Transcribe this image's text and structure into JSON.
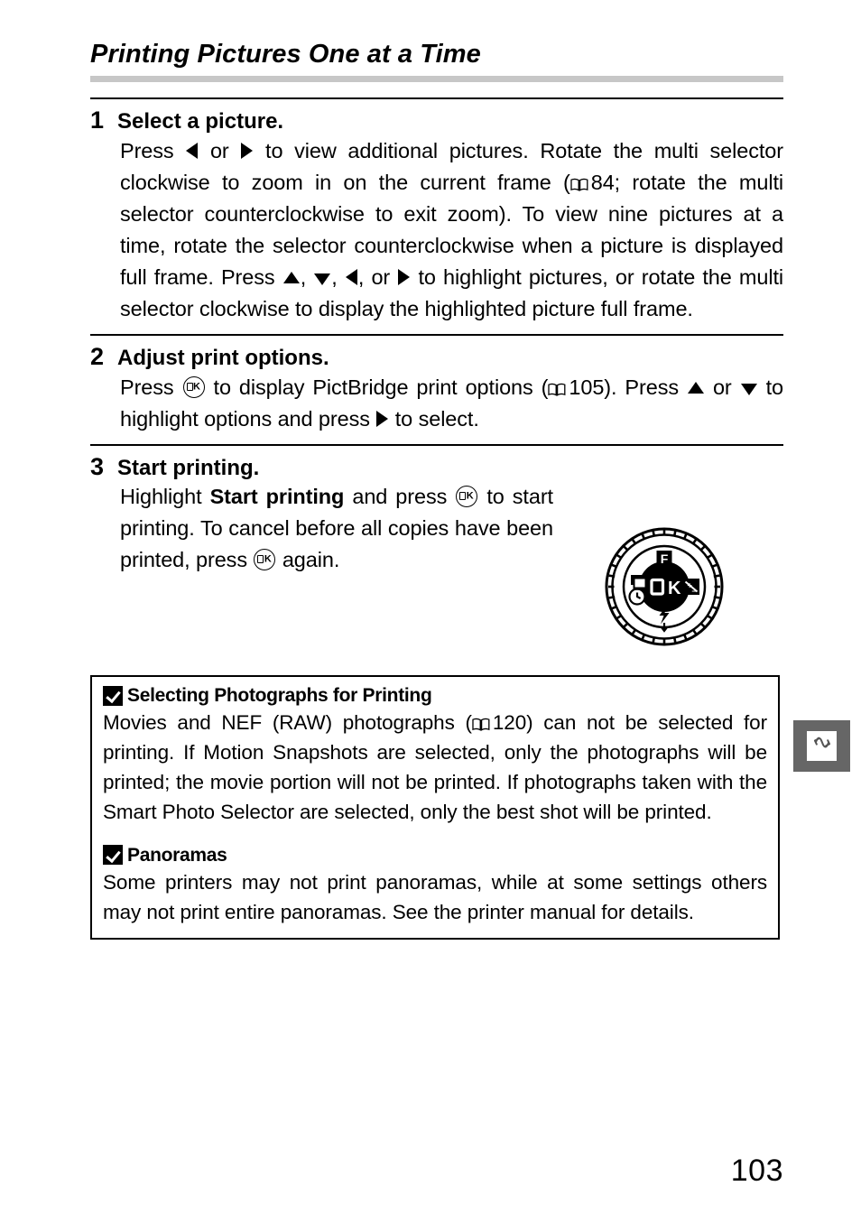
{
  "page": {
    "title": "Printing Pictures One at a Time",
    "number": "103"
  },
  "steps": [
    {
      "num": "1",
      "title": "Select a picture.",
      "body_parts": {
        "p1": "Press ",
        "p2": " or ",
        "p3": " to view additional pictures. Rotate the multi selector clockwise to zoom in on the current frame (",
        "ref1": "84",
        "p4": "; rotate the multi selector counterclockwise to exit zoom).  To view nine pictures at a time, rotate the selector counterclockwise when a picture is displayed full frame.  Press ",
        "p5": ", ",
        "p6": ", ",
        "p7": ", or ",
        "p8": " to highlight pictures, or rotate the multi selector clockwise to display the highlighted picture full frame."
      }
    },
    {
      "num": "2",
      "title": "Adjust print options.",
      "body_parts": {
        "p1": "Press ",
        "p2": " to display PictBridge print options (",
        "ref1": "105",
        "p3": ").  Press ",
        "p4": " or ",
        "p5": " to highlight options and press ",
        "p6": " to select."
      }
    },
    {
      "num": "3",
      "title": "Start printing.",
      "body_parts": {
        "p1": "Highlight ",
        "bold1": "Start printing",
        "p2": " and press ",
        "p3": " to start printing.  To cancel before all copies have been printed, press ",
        "p4": " again."
      }
    }
  ],
  "dial": {
    "center_label": "OK",
    "top_label": "F",
    "left_top_icon": "release-mode-icon",
    "left_bottom_icon": "self-timer-icon",
    "right_icon": "exposure-compensation-icon",
    "bottom_icon": "flash-icon"
  },
  "notes": [
    {
      "heading": "Selecting Photographs for Printing",
      "body_parts": {
        "p1": "Movies and NEF (RAW) photographs (",
        "ref1": "120",
        "p2": ") can not be selected for printing.  If Motion Snapshots are selected, only the photographs will be printed; the movie portion will not be printed. If photographs taken with the Smart Photo Selector are selected, only the best shot will be printed."
      }
    },
    {
      "heading": "Panoramas",
      "body_parts": {
        "p1": "Some printers may not print panoramas, while at some settings others may not print entire panoramas. See the printer manual for details."
      }
    }
  ],
  "side_tab": {
    "icon": "connect-to-device-icon"
  },
  "colors": {
    "title_rule": "#c7c7c7",
    "side_tab_bg": "#666666",
    "text": "#000000"
  }
}
